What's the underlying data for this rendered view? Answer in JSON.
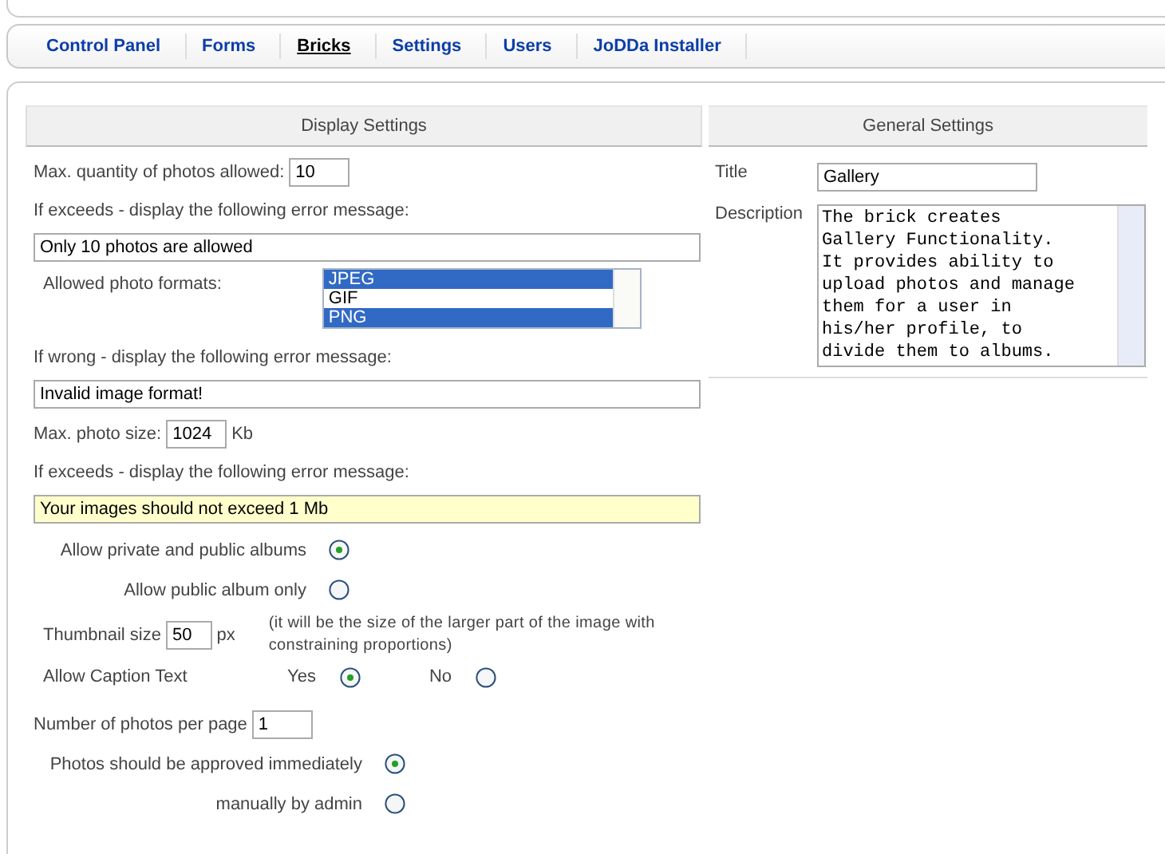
{
  "tabs": [
    {
      "label": "Control Panel",
      "selected": false
    },
    {
      "label": "Forms",
      "selected": false
    },
    {
      "label": "Bricks",
      "selected": true
    },
    {
      "label": "Settings",
      "selected": false
    },
    {
      "label": "Users",
      "selected": false
    },
    {
      "label": "JoDDa Installer",
      "selected": false
    }
  ],
  "display_settings": {
    "title": "Display Settings",
    "max_quantity": {
      "label": "Max. quantity of photos allowed:",
      "value": "10"
    },
    "exceed_message": {
      "label": "If exceeds - display the following error message:",
      "value": "Only 10 photos are allowed",
      "focused": false
    },
    "formats": {
      "label": "Allowed photo formats:",
      "options": [
        {
          "label": "JPEG",
          "selected": true
        },
        {
          "label": "GIF",
          "selected": false
        },
        {
          "label": "PNG",
          "selected": true
        }
      ]
    },
    "wrong_message": {
      "label": "If wrong - display the following error message:",
      "value": "Invalid image format!",
      "focused": false
    },
    "max_size": {
      "label": "Max. photo size:",
      "value": "1024",
      "unit": "Kb"
    },
    "size_message": {
      "label": "If exceeds - display the following error message:",
      "value": "Your images should not exceed 1 Mb",
      "focused": true
    },
    "album_access": [
      {
        "label": "Allow private and public albums",
        "selected": true
      },
      {
        "label": "Allow public album only",
        "selected": false
      }
    ],
    "thumbnail": {
      "label": "Thumbnail size",
      "value": "50",
      "unit": "px",
      "note": "(it will be the size of the larger part of the image with constraining proportions)"
    },
    "caption": {
      "label": "Allow Caption Text",
      "options": [
        {
          "label": "Yes",
          "selected": true
        },
        {
          "label": "No",
          "selected": false
        }
      ]
    },
    "per_page": {
      "label": "Number of photos per page",
      "value": "1"
    },
    "approval": [
      {
        "label": "Photos should be approved immediately",
        "selected": true
      },
      {
        "label": "manually by admin",
        "selected": false
      }
    ]
  },
  "general_settings": {
    "title": "General Settings",
    "title_field": {
      "label": "Title",
      "value": "Gallery"
    },
    "description": {
      "label": "Description",
      "value": "The brick creates Gallery Functionality. It provides ability to upload photos and manage them for a user in his/her profile, to divide them to albums."
    }
  }
}
